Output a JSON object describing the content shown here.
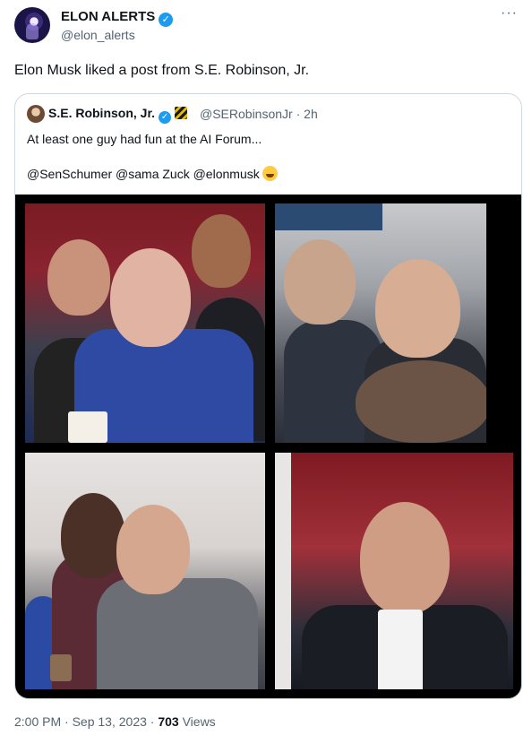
{
  "author": {
    "display_name": "ELON ALERTS",
    "handle": "@elon_alerts",
    "verified_glyph": "✓"
  },
  "more_icon": "···",
  "tweet_text": "Elon Musk liked a post from S.E. Robinson, Jr.",
  "quote": {
    "author_name": "S.E. Robinson, Jr.",
    "author_handle": "@SERobinsonJr",
    "time_ago": "2h",
    "separator": "·",
    "text_line1": "At least one guy had fun at the AI Forum...",
    "text_line2": "@SenSchumer @sama Zuck @elonmusk",
    "emoji": "grinning-squinting-face"
  },
  "footer": {
    "time": "2:00 PM",
    "separator": "·",
    "date": "Sep 13, 2023",
    "views_count": "703",
    "views_label": "Views"
  },
  "colors": {
    "verified_blue": "#1d9bf0",
    "secondary_text": "#536471",
    "border": "#cfd9de"
  }
}
